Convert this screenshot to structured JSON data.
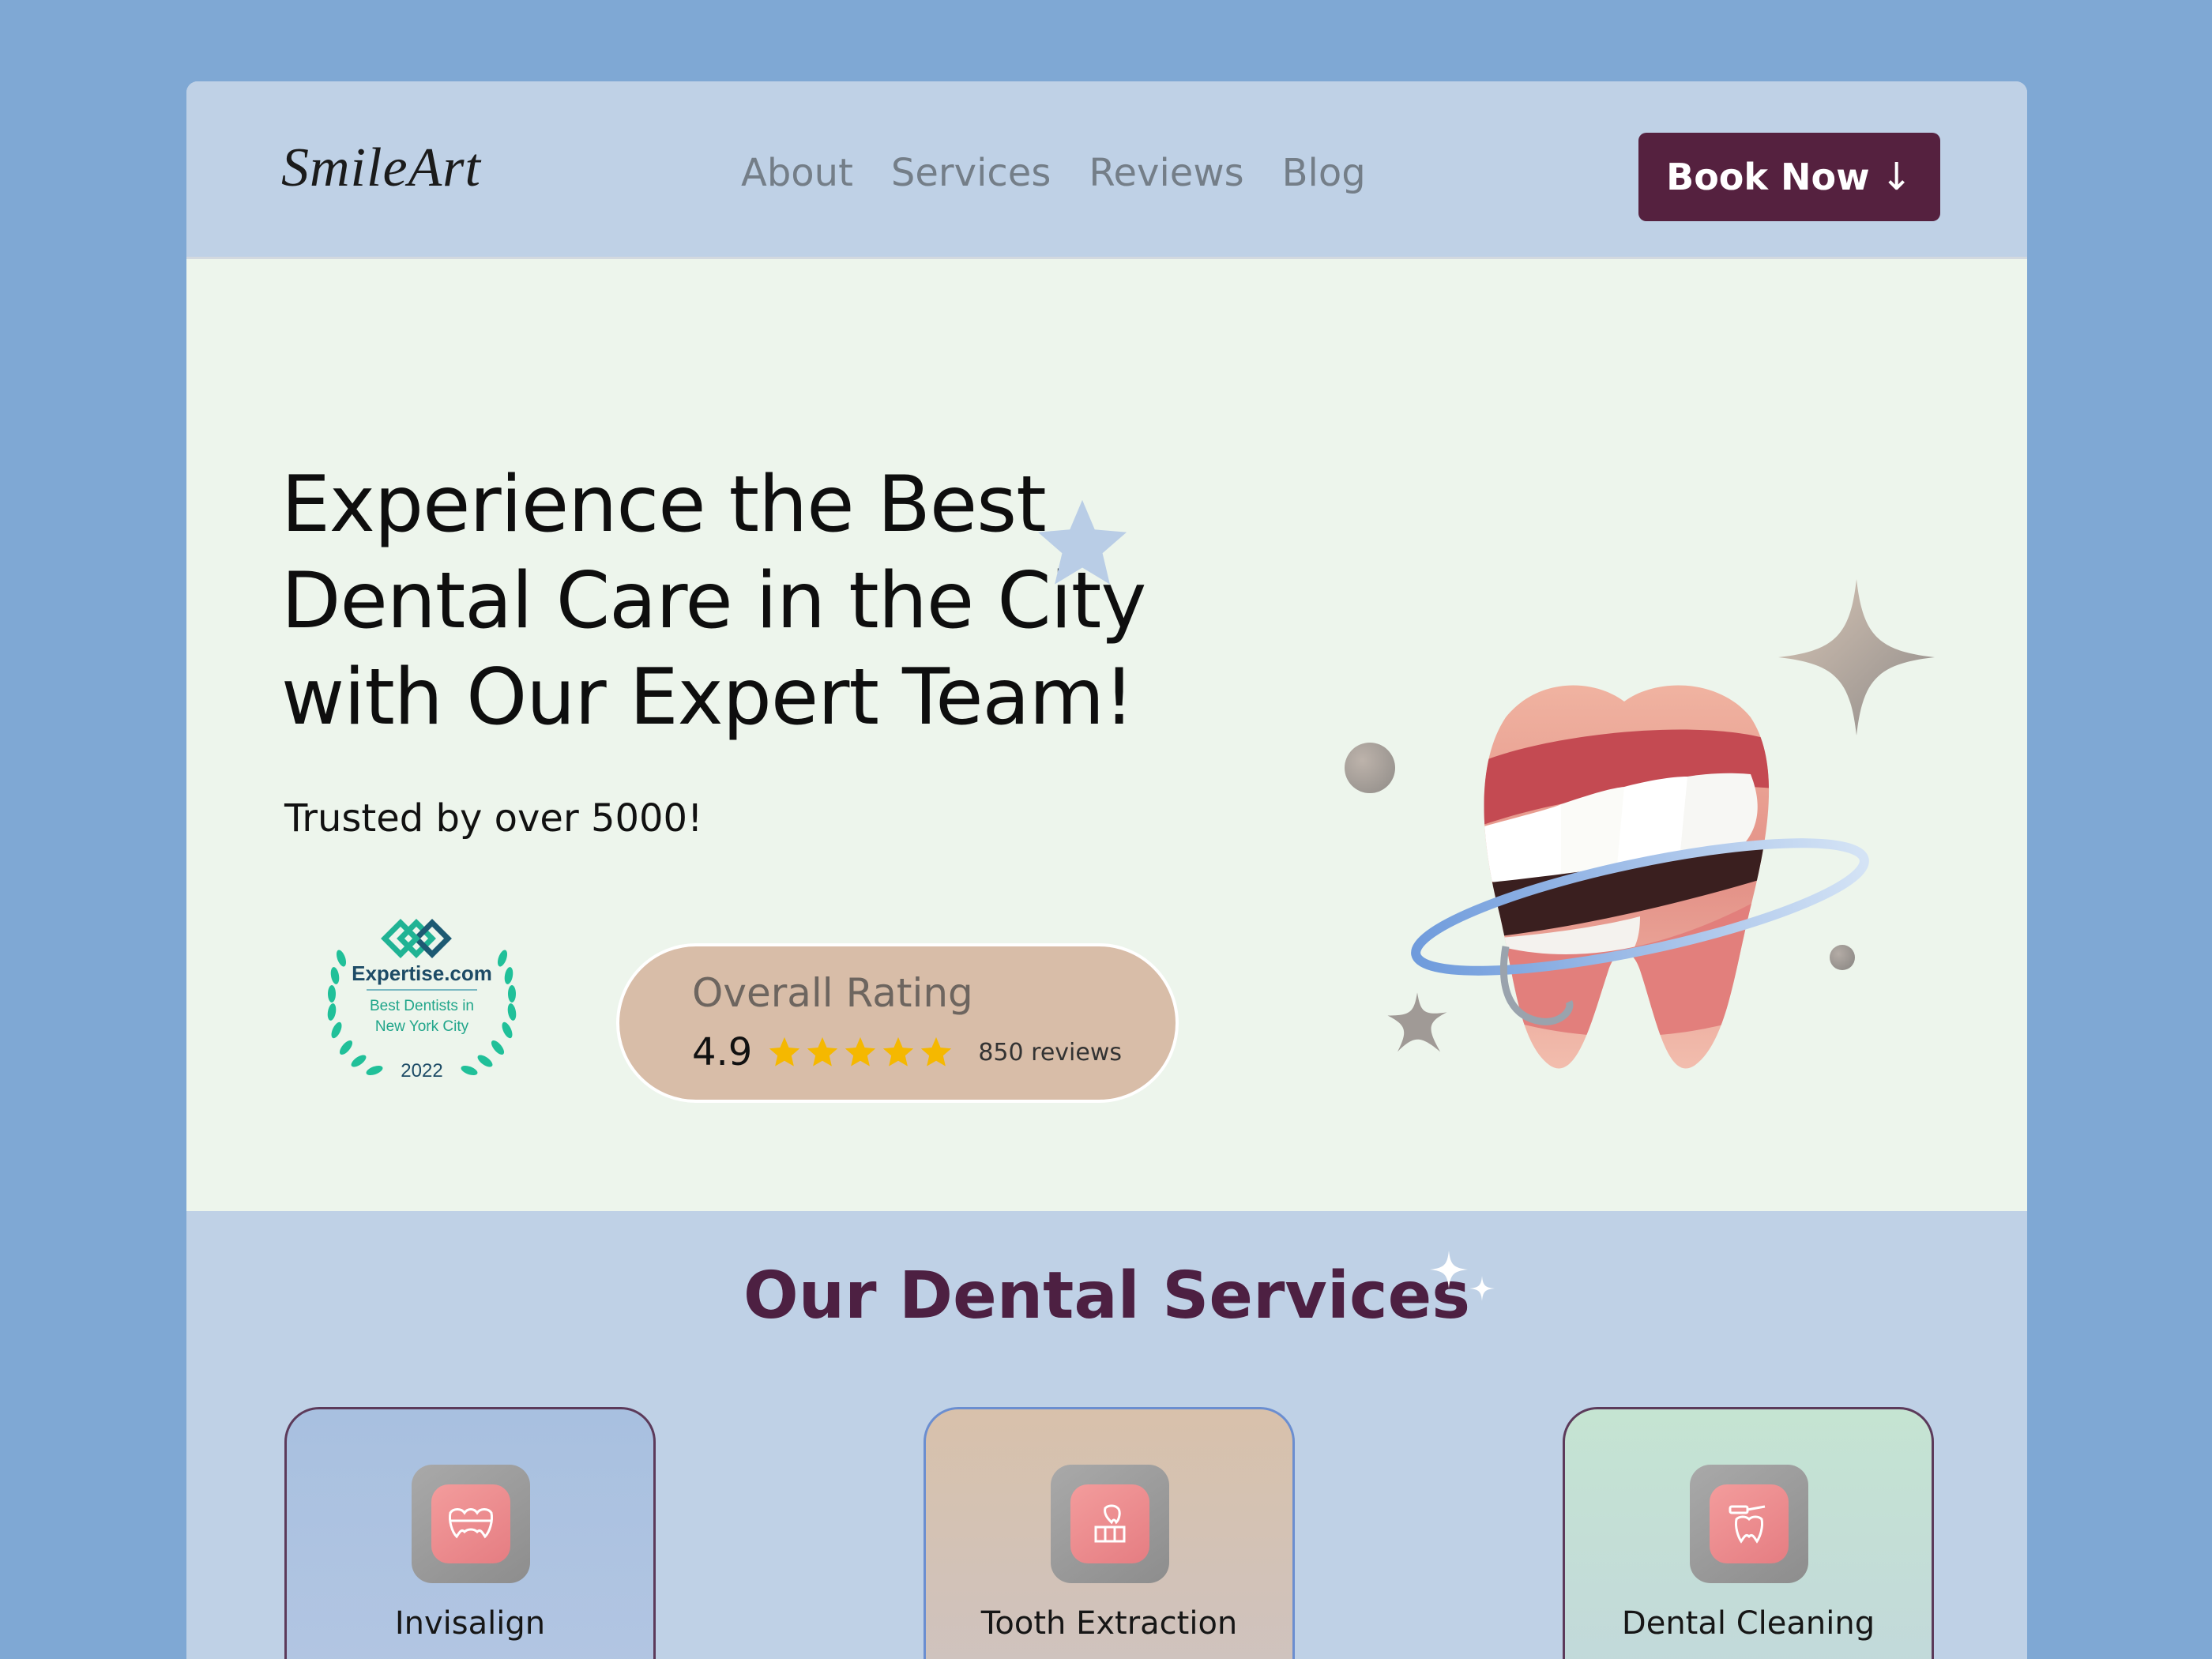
{
  "brand": {
    "logo": "SmileArt"
  },
  "nav": {
    "links": [
      "About",
      "Services",
      "Reviews",
      "Blog"
    ],
    "cta_label": "Book Now",
    "cta_arrow": "↓"
  },
  "hero": {
    "title_lines": [
      "Experience the Best",
      "Dental Care in the City",
      "with Our Expert Team!"
    ],
    "subtitle": "Trusted by over 5000!",
    "badge": {
      "brand": "Expertise.com",
      "line1": "Best Dentists in",
      "line2": "New York City",
      "year": "2022"
    },
    "rating": {
      "title": "Overall Rating",
      "score": "4.9",
      "stars": 5,
      "count": "850 reviews",
      "star_color": "#f5b800"
    }
  },
  "services": {
    "title": "Our Dental Services",
    "items": [
      {
        "label": "Invisalign",
        "icon": "braces-icon"
      },
      {
        "label": "Tooth Extraction",
        "icon": "tooth-extraction-icon"
      },
      {
        "label": "Dental Cleaning",
        "icon": "dental-cleaning-icon"
      }
    ]
  },
  "colors": {
    "background": "#7fa8d4",
    "nav_bg": "#bfd1e6",
    "hero_bg": "#edf5ec",
    "cta_bg": "#55213f",
    "services_title": "#4d2042"
  }
}
